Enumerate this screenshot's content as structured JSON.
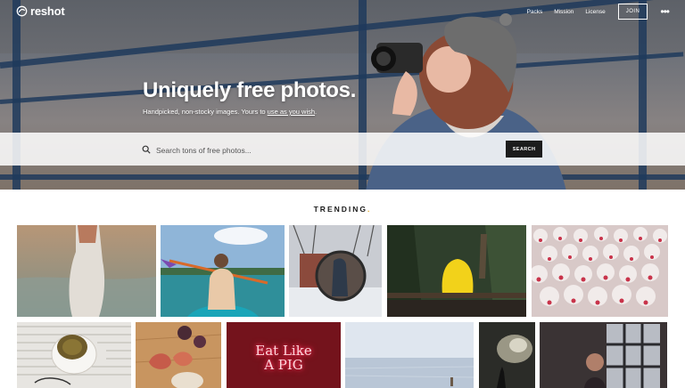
{
  "brand": {
    "logo_text": "reshot"
  },
  "nav": {
    "items": [
      "Packs",
      "Mission",
      "License"
    ],
    "join_label": "JOIN",
    "more_icon": "more-dots-icon"
  },
  "hero": {
    "title": "Uniquely free photos.",
    "subtitle_before": "Handpicked, non-stocky images. Yours to ",
    "subtitle_link": "use as you wish",
    "subtitle_after": "."
  },
  "search": {
    "placeholder": "Search tons of free photos...",
    "button_label": "SEARCH",
    "icon": "search-icon"
  },
  "trending": {
    "label": "TRENDING",
    "dot": "."
  },
  "photos": {
    "row1": [
      "woman-in-sea",
      "kayaker",
      "snowy-mirror",
      "yellow-hoodie-bench",
      "lucky-cats"
    ],
    "row2": [
      "tea-cup-newspaper",
      "figs-on-table",
      "eat-like-a-pig-neon",
      "pale-sea",
      "dark-clouds-hand",
      "window-portrait"
    ],
    "neon_text_line1": "Eat Like",
    "neon_text_line2": "A PIG"
  },
  "colors": {
    "accent_dot": "#e0a31a",
    "button_bg": "#1c1c1c",
    "neon": "#ff2d55"
  }
}
